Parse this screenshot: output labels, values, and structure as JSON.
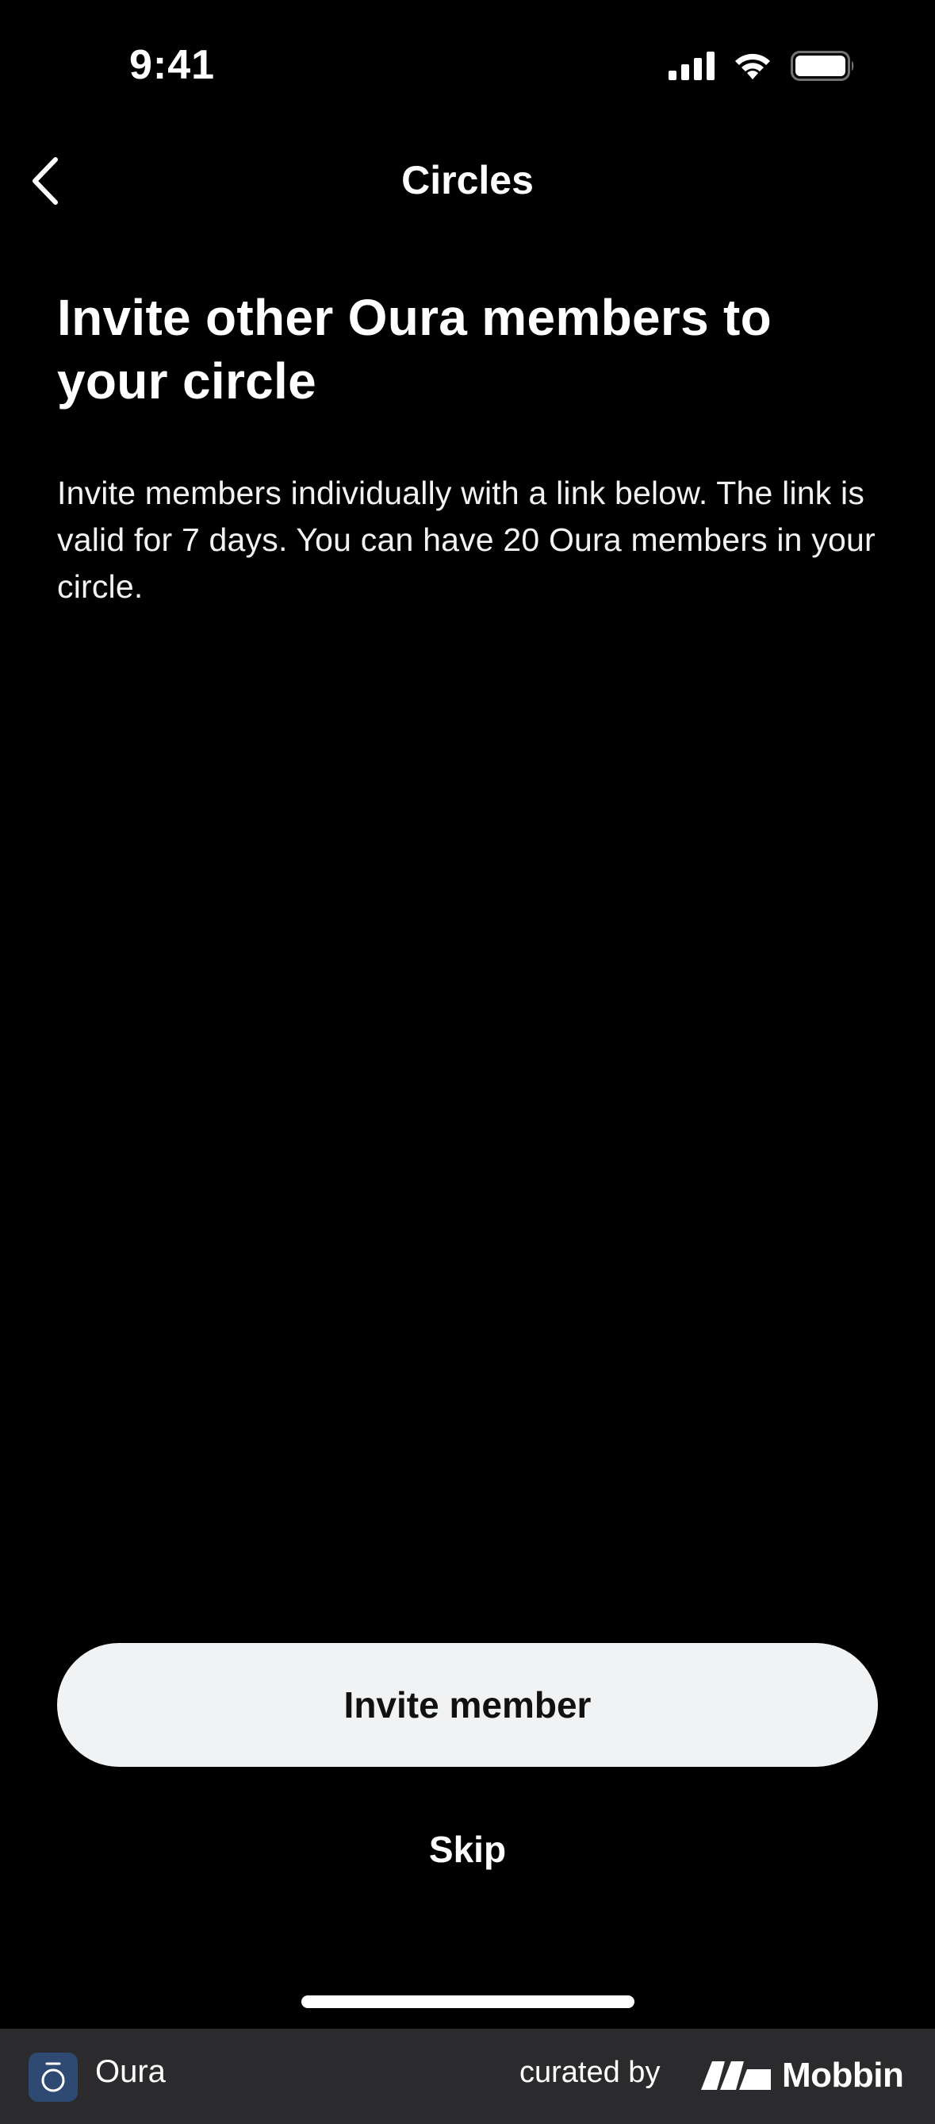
{
  "status_bar": {
    "time": "9:41",
    "icons": [
      "signal-icon",
      "wifi-icon",
      "battery-icon"
    ]
  },
  "nav": {
    "back_icon": "chevron-left-icon",
    "title": "Circles"
  },
  "main": {
    "heading": "Invite other Oura members to your circle",
    "description": "Invite members individually with a link below. The link is valid for 7 days. You can have 20 Oura members in your circle."
  },
  "actions": {
    "invite_label": "Invite member",
    "skip_label": "Skip"
  },
  "footer": {
    "app_icon": "oura-ring-icon",
    "app_name": "Oura",
    "curated_by": "curated by",
    "brand": "Mobbin",
    "brand_icon": "mobbin-logo-icon"
  },
  "colors": {
    "background": "#000000",
    "text": "#ffffff",
    "button_bg": "#f1f2f3",
    "button_text": "#111111",
    "footer_bg": "#2b2b2d",
    "app_icon_bg": "#2e4a73"
  }
}
